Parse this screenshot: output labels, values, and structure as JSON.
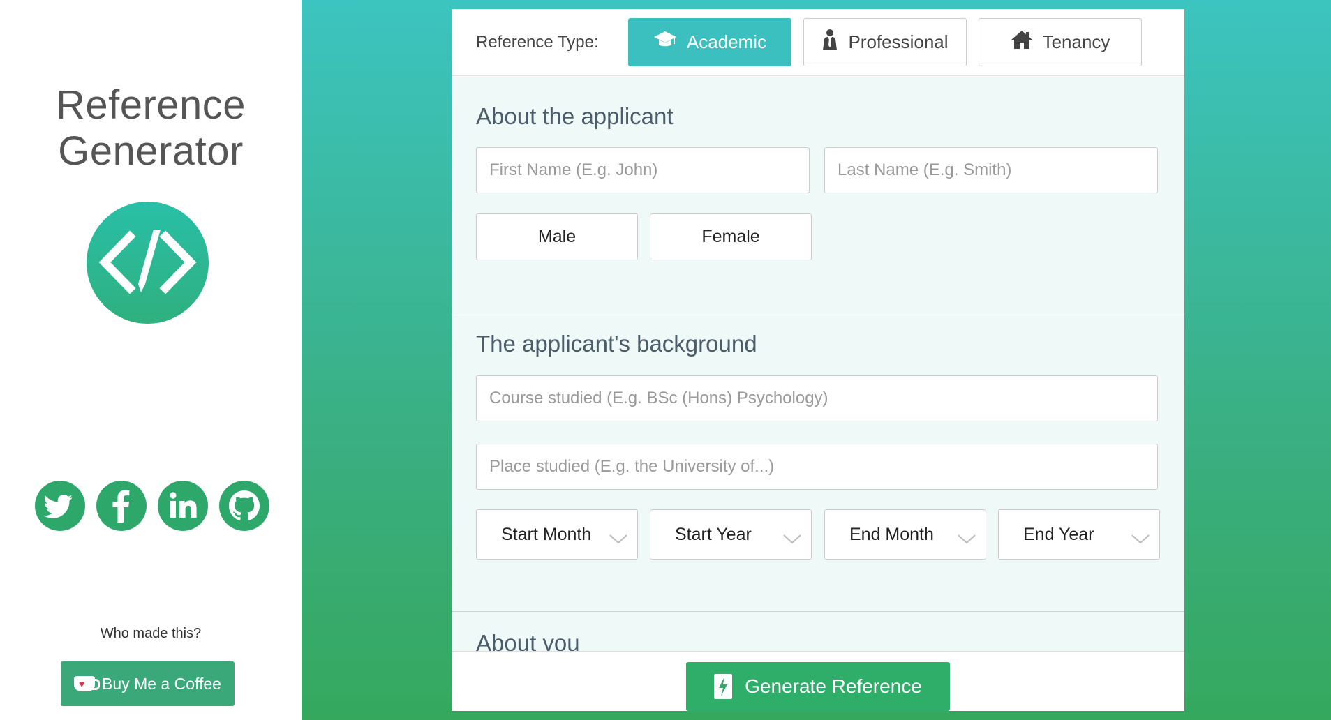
{
  "sidebar": {
    "title_line1": "Reference",
    "title_line2": "Generator",
    "logo_icon": "code-pencil-icon",
    "socials": [
      "twitter-icon",
      "facebook-icon",
      "linkedin-icon",
      "github-icon"
    ],
    "who_made": "Who made this?",
    "coffee_label": "Buy Me a Coffee"
  },
  "reference_type": {
    "label": "Reference Type:",
    "options": [
      {
        "label": "Academic",
        "icon": "graduation-cap-icon",
        "active": true
      },
      {
        "label": "Professional",
        "icon": "person-tie-icon",
        "active": false
      },
      {
        "label": "Tenancy",
        "icon": "home-icon",
        "active": false
      }
    ]
  },
  "about_applicant": {
    "title": "About the applicant",
    "first_name_placeholder": "First Name (E.g. John)",
    "last_name_placeholder": "Last Name (E.g. Smith)",
    "gender_male": "Male",
    "gender_female": "Female"
  },
  "background": {
    "title": "The applicant's background",
    "course_placeholder": "Course studied (E.g. BSc (Hons) Psychology)",
    "place_placeholder": "Place studied (E.g. the University of...)",
    "start_month": "Start Month",
    "start_year": "Start Year",
    "end_month": "End Month",
    "end_year": "End Year"
  },
  "about_you": {
    "title": "About you"
  },
  "footer": {
    "generate_label": "Generate Reference"
  },
  "colors": {
    "accent_teal": "#3cbfbf",
    "accent_green": "#2fae6a",
    "form_bg": "#eef9f8"
  }
}
